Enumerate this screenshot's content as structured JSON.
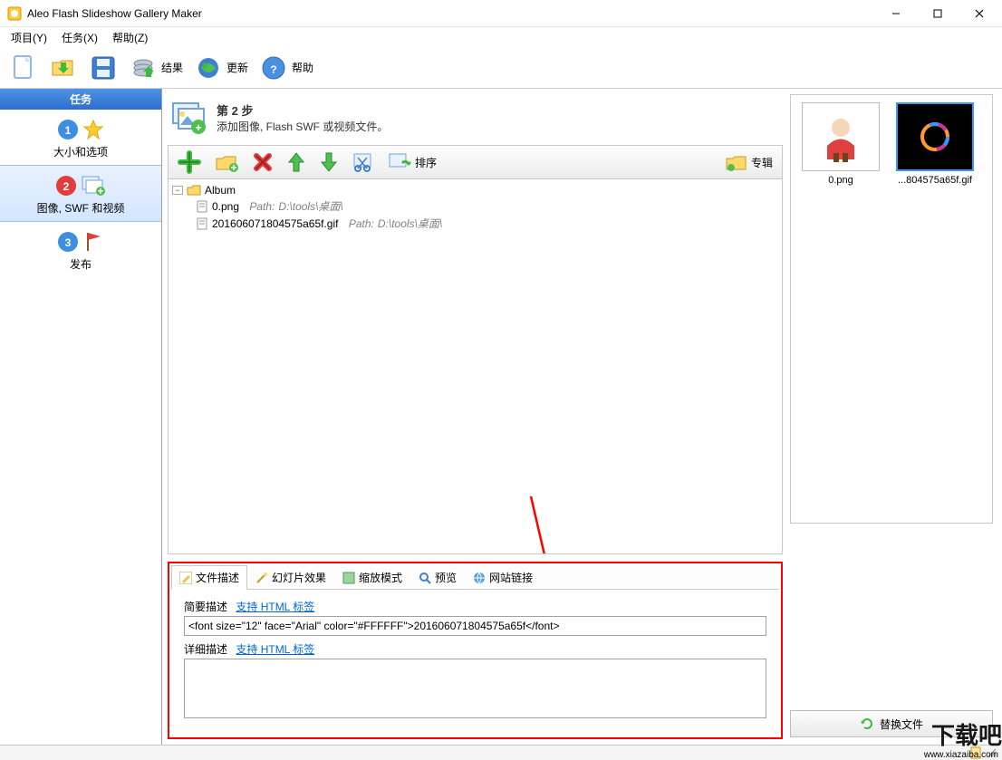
{
  "window": {
    "title": "Aleo Flash Slideshow Gallery Maker"
  },
  "menu": {
    "items": [
      "项目(Y)",
      "任务(X)",
      "帮助(Z)"
    ]
  },
  "toolbar": {
    "result": "结果",
    "update": "更新",
    "help": "帮助"
  },
  "sidebar": {
    "header": "任务",
    "items": [
      {
        "label": "大小和选项"
      },
      {
        "label": "图像, SWF 和视频"
      },
      {
        "label": "发布"
      }
    ]
  },
  "step": {
    "title": "第 2 步",
    "subtitle": "添加图像, Flash SWF 或视频文件。"
  },
  "center_toolbar": {
    "sort": "排序",
    "album": "专辑"
  },
  "tree": {
    "root": "Album",
    "items": [
      {
        "name": "0.png",
        "path_label": "Path:",
        "path": "D:\\tools\\桌面\\"
      },
      {
        "name": "201606071804575a65f.gif",
        "path_label": "Path:",
        "path": "D:\\tools\\桌面\\"
      }
    ]
  },
  "tabs": {
    "items": [
      "文件描述",
      "幻灯片效果",
      "缩放模式",
      "预览",
      "网站链接"
    ]
  },
  "desc": {
    "brief_label": "简要描述",
    "html_link": "支持 HTML 标签",
    "brief_value": "<font size=\"12\" face=\"Arial\" color=\"#FFFFFF\">201606071804575a65f</font>",
    "detail_label": "详细描述",
    "detail_value": ""
  },
  "thumbs": {
    "items": [
      {
        "label": "0.png"
      },
      {
        "label": "...804575a65f.gif"
      }
    ]
  },
  "replace_button": "替换文件",
  "watermark": {
    "big": "下载吧",
    "small": "www.xiazaiba.com"
  }
}
